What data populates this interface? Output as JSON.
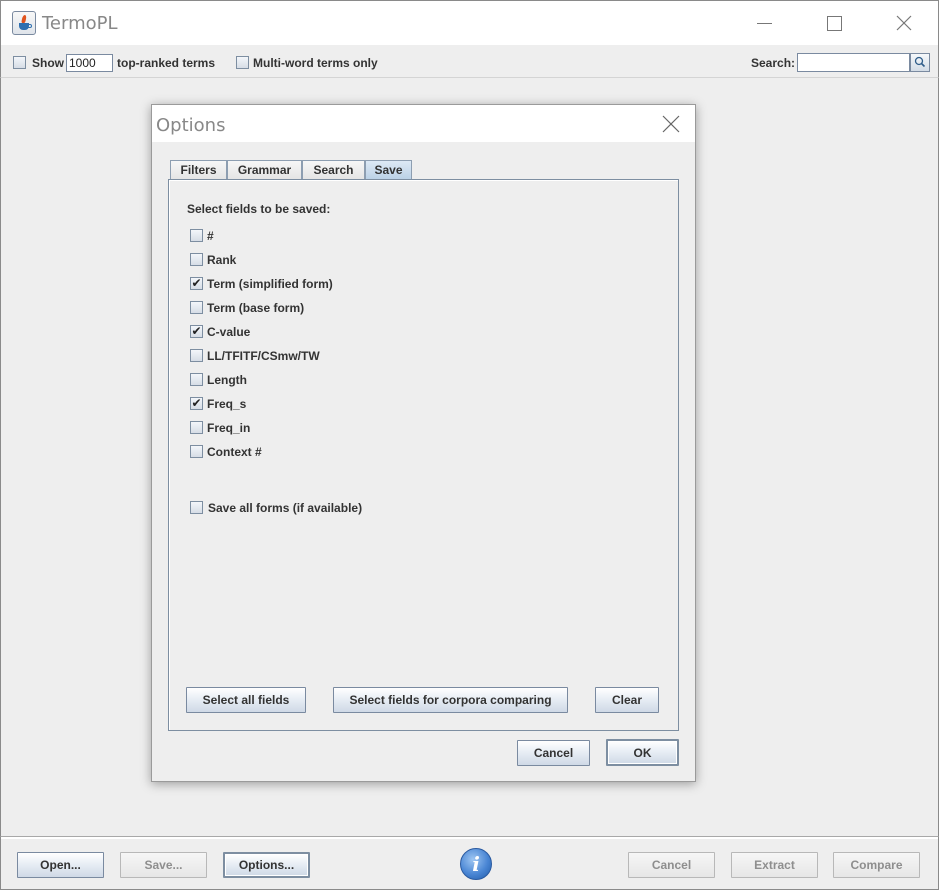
{
  "window": {
    "title": "TermoPL"
  },
  "toolbar": {
    "show_label": "Show",
    "show_count_value": "1000",
    "top_ranked_label": "top-ranked terms",
    "show_checked": false,
    "multiword_label": "Multi-word terms only",
    "multiword_checked": false,
    "search_label": "Search:",
    "search_value": ""
  },
  "dialog": {
    "title": "Options",
    "tabs": [
      {
        "label": "Filters",
        "selected": false
      },
      {
        "label": "Grammar",
        "selected": false
      },
      {
        "label": "Search",
        "selected": false
      },
      {
        "label": "Save",
        "selected": true
      }
    ],
    "heading": "Select fields to be saved:",
    "fields": [
      {
        "label": "#",
        "checked": false
      },
      {
        "label": "Rank",
        "checked": false
      },
      {
        "label": "Term (simplified form)",
        "checked": true
      },
      {
        "label": "Term (base form)",
        "checked": false
      },
      {
        "label": "C-value",
        "checked": true
      },
      {
        "label": "LL/TFITF/CSmw/TW",
        "checked": false
      },
      {
        "label": "Length",
        "checked": false
      },
      {
        "label": "Freq_s",
        "checked": true
      },
      {
        "label": "Freq_in",
        "checked": false
      },
      {
        "label": "Context #",
        "checked": false
      }
    ],
    "save_all_forms": {
      "label": "Save all forms (if available)",
      "checked": false
    },
    "buttons": {
      "select_all": "Select all fields",
      "select_corpora": "Select fields for corpora comparing",
      "clear": "Clear",
      "cancel": "Cancel",
      "ok": "OK"
    }
  },
  "bottom": {
    "open": "Open...",
    "save": "Save...",
    "options": "Options...",
    "info_glyph": "i",
    "cancel": "Cancel",
    "extract": "Extract",
    "compare": "Compare"
  },
  "colors": {
    "accent_tab": "#b8cfe5",
    "border": "#7d8ea1",
    "info_blue": "#4a86d4"
  },
  "icons": {
    "app": "java-cup-icon",
    "search": "magnifier-icon",
    "info": "info-icon"
  }
}
